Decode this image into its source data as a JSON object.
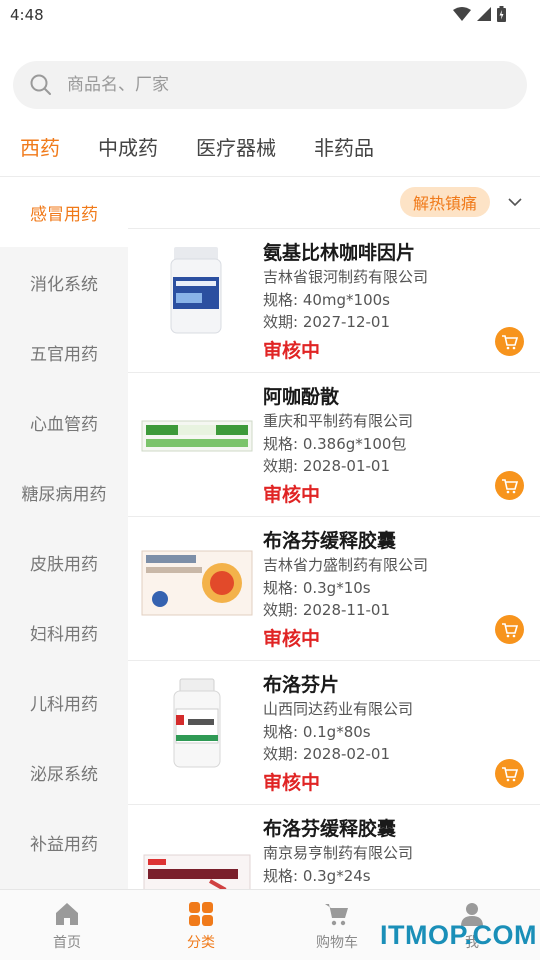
{
  "status_bar": {
    "time": "4:48"
  },
  "search": {
    "placeholder": "商品名、厂家"
  },
  "top_tabs": [
    {
      "label": "西药",
      "active": true
    },
    {
      "label": "中成药",
      "active": false
    },
    {
      "label": "医疗器械",
      "active": false
    },
    {
      "label": "非药品",
      "active": false
    }
  ],
  "sidebar": [
    {
      "label": "感冒用药",
      "active": true
    },
    {
      "label": "消化系统",
      "active": false
    },
    {
      "label": "五官用药",
      "active": false
    },
    {
      "label": "心血管药",
      "active": false
    },
    {
      "label": "糖尿病用药",
      "active": false
    },
    {
      "label": "皮肤用药",
      "active": false
    },
    {
      "label": "妇科用药",
      "active": false
    },
    {
      "label": "儿科用药",
      "active": false
    },
    {
      "label": "泌尿系统",
      "active": false
    },
    {
      "label": "补益用药",
      "active": false
    }
  ],
  "subcategory": {
    "label": "解热镇痛"
  },
  "products": [
    {
      "name": "氨基比林咖啡因片",
      "maker": "吉林省银河制药有限公司",
      "spec": "规格: 40mg*100s",
      "expiry": "效期: 2027-12-01",
      "status": "审核中",
      "img": "bottle-blue"
    },
    {
      "name": "阿咖酚散",
      "maker": "重庆和平制药有限公司",
      "spec": "规格: 0.386g*100包",
      "expiry": "效期: 2028-01-01",
      "status": "审核中",
      "img": "green-packet"
    },
    {
      "name": "布洛芬缓释胶囊",
      "maker": "吉林省力盛制药有限公司",
      "spec": "规格: 0.3g*10s",
      "expiry": "效期: 2028-11-01",
      "status": "审核中",
      "img": "box-red-figure"
    },
    {
      "name": "布洛芬片",
      "maker": "山西同达药业有限公司",
      "spec": "规格: 0.1g*80s",
      "expiry": "效期: 2028-02-01",
      "status": "审核中",
      "img": "bottle-white-red"
    },
    {
      "name": "布洛芬缓释胶囊",
      "maker": "南京易亨制药有限公司",
      "spec": "规格: 0.3g*24s",
      "expiry": "",
      "status": "",
      "img": "box-runner"
    }
  ],
  "bottom_nav": [
    {
      "label": "首页",
      "icon": "home-icon",
      "active": false
    },
    {
      "label": "分类",
      "icon": "category-icon",
      "active": true
    },
    {
      "label": "购物车",
      "icon": "cart-icon",
      "active": false
    },
    {
      "label": "我",
      "icon": "user-icon",
      "active": false
    }
  ],
  "watermark": "ITMOP.COM",
  "colors": {
    "accent": "#f07a1a",
    "status_red": "#e02424",
    "cart_orange": "#f7941d",
    "tag_bg": "#fde3c6"
  }
}
